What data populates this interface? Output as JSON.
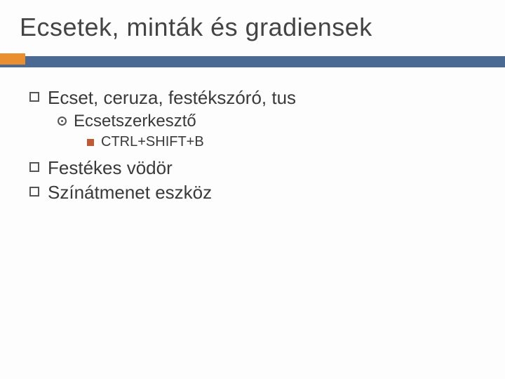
{
  "title": "Ecsetek, minták és gradiensek",
  "items": [
    {
      "text": "Ecset, ceruza, festékszóró, tus"
    },
    {
      "text": "Ecsetszerkesztő"
    },
    {
      "text": "CTRL+SHIFT+B"
    },
    {
      "text": "Festékes vödör"
    },
    {
      "text": "Színátmenet eszköz"
    }
  ]
}
